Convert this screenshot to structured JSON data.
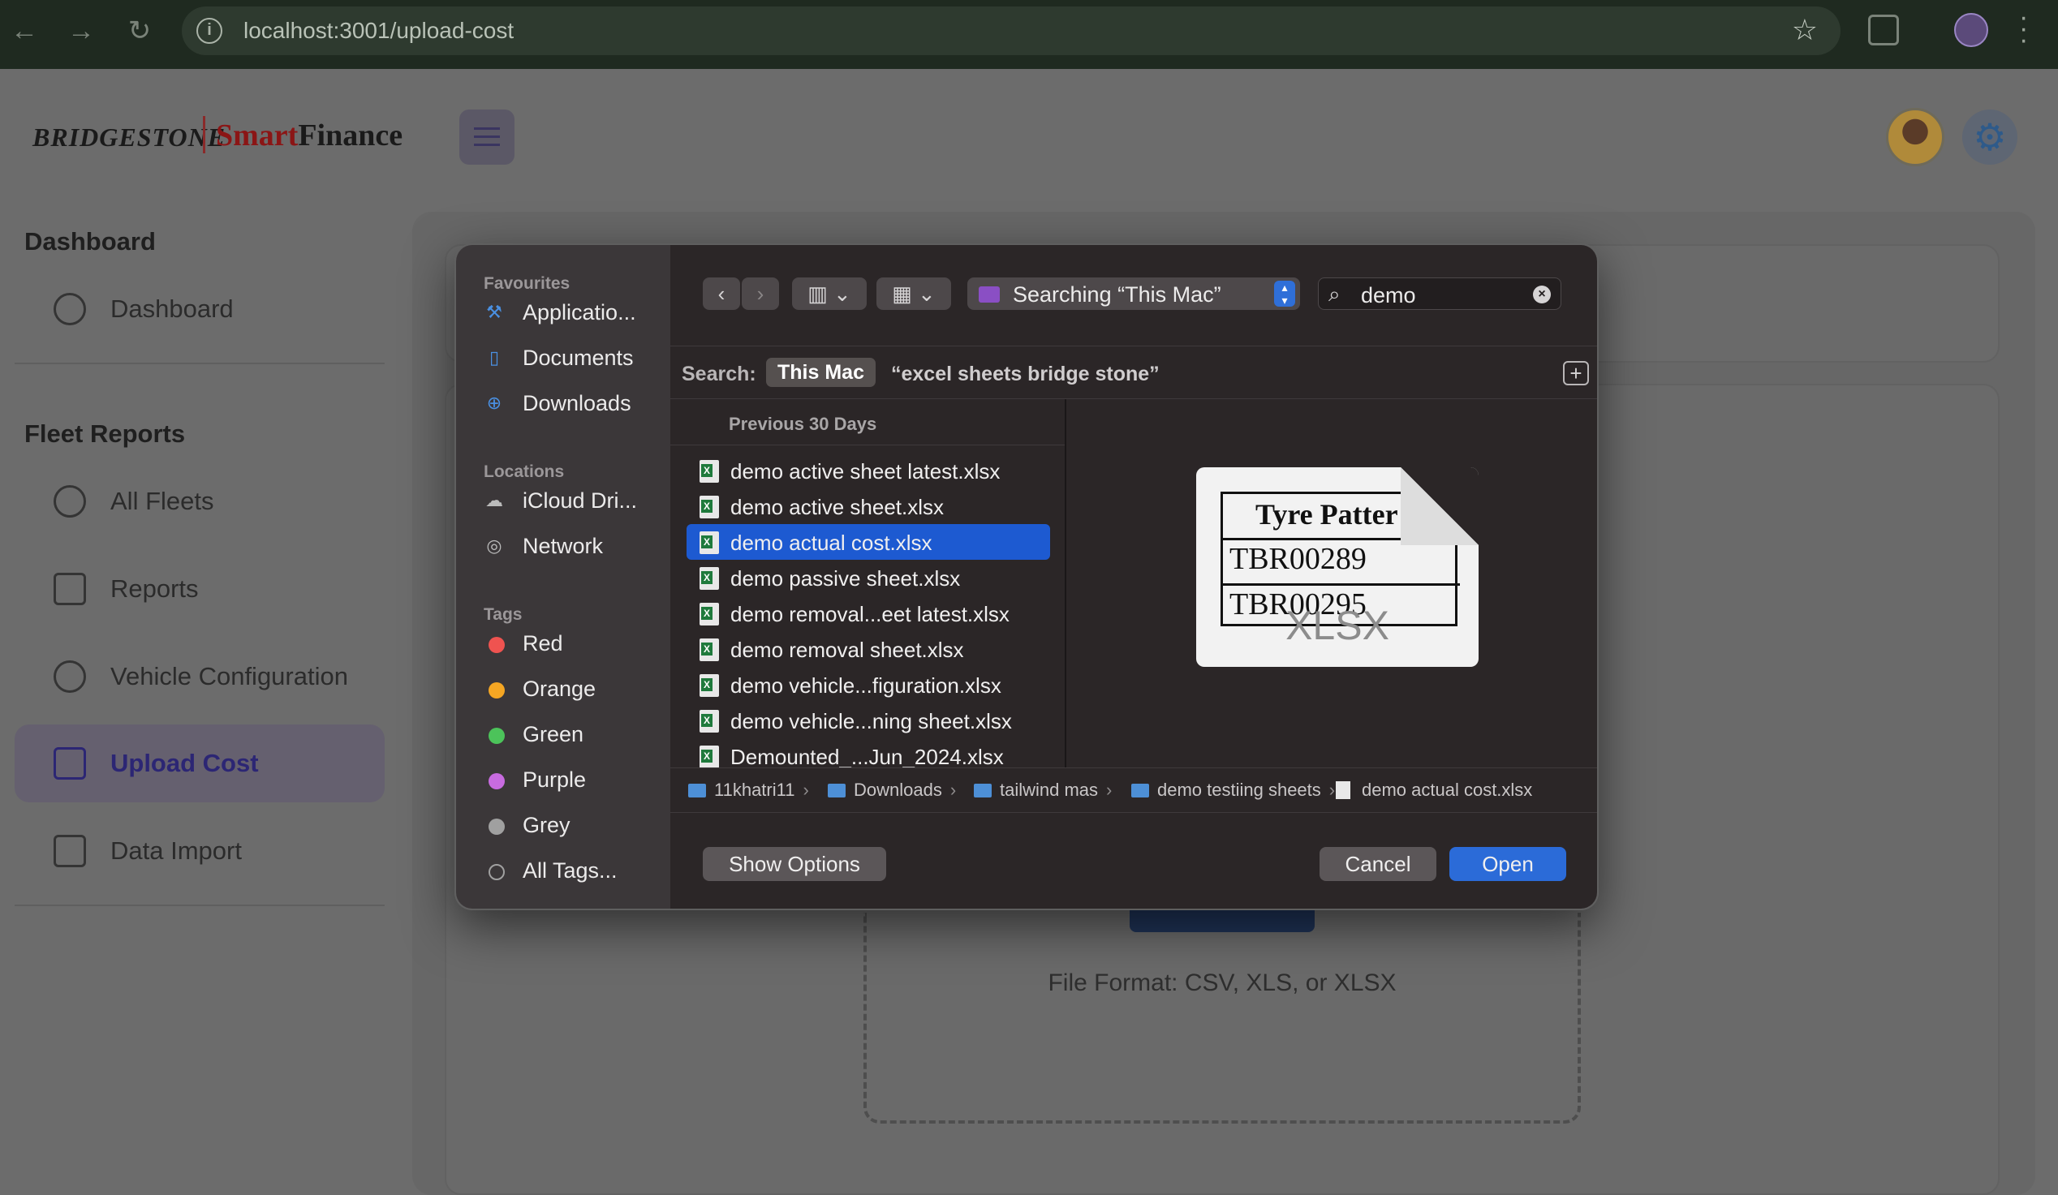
{
  "browser": {
    "url": "localhost:3001/upload-cost"
  },
  "header": {
    "brand": "BRIDGESTONE",
    "app_name_1": "Smart",
    "app_name_2": "Finance"
  },
  "sidebar": {
    "sections": [
      {
        "title": "Dashboard",
        "items": [
          {
            "label": "Dashboard",
            "icon": "gauge-icon"
          }
        ]
      },
      {
        "title": "Fleet Reports",
        "items": [
          {
            "label": "All Fleets",
            "icon": "gauge-icon"
          },
          {
            "label": "Reports",
            "icon": "report-clock-icon"
          },
          {
            "label": "Vehicle Configuration",
            "icon": "gear-icon"
          },
          {
            "label": "Upload Cost",
            "icon": "upload-icon",
            "active": true
          },
          {
            "label": "Data Import",
            "icon": "file-import-icon"
          }
        ]
      }
    ]
  },
  "upload": {
    "format_hint": "File Format: CSV, XLS, or XLSX"
  },
  "dialog": {
    "favourites_title": "Favourites",
    "favourites": [
      "Applicatio...",
      "Documents",
      "Downloads"
    ],
    "locations_title": "Locations",
    "locations": [
      "iCloud Dri...",
      "Network"
    ],
    "tags_title": "Tags",
    "tags": [
      {
        "label": "Red",
        "color": "#ef5350"
      },
      {
        "label": "Orange",
        "color": "#f5a623"
      },
      {
        "label": "Green",
        "color": "#4cc35a"
      },
      {
        "label": "Purple",
        "color": "#c86be0"
      },
      {
        "label": "Grey",
        "color": "#a0a0a0"
      },
      {
        "label": "All Tags...",
        "color": ""
      }
    ],
    "location_selector": "Searching “This Mac”",
    "search_value": "demo",
    "scope_label": "Search:",
    "scope_chip": "This Mac",
    "scope_query": "“excel sheets bridge stone”",
    "list_header": "Previous 30 Days",
    "files": [
      "demo active sheet latest.xlsx",
      "demo active sheet.xlsx",
      "demo actual cost.xlsx",
      "demo passive sheet.xlsx",
      "demo removal...eet latest.xlsx",
      "demo removal sheet.xlsx",
      "demo vehicle...figuration.xlsx",
      "demo vehicle...ning sheet.xlsx",
      "Demounted_...Jun_2024.xlsx"
    ],
    "selected_index": 2,
    "preview": {
      "row1": "Tyre Patter",
      "row2": "TBR00289",
      "row3": "TBR00295",
      "ext": "XLSX"
    },
    "path": [
      "11khatri11",
      "Downloads",
      "tailwind mas",
      "demo testiing sheets",
      "demo actual cost.xlsx"
    ],
    "show_options": "Show Options",
    "cancel": "Cancel",
    "open": "Open"
  }
}
